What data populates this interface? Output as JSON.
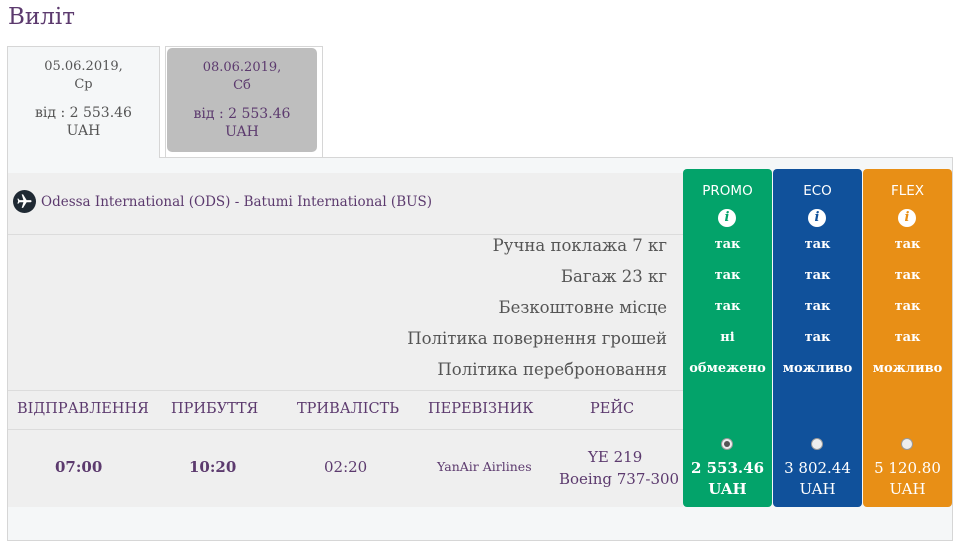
{
  "section_title": "Виліт",
  "date_tabs": [
    {
      "date": "05.06.2019,",
      "weekday": "Ср",
      "price": "від : 2 553.46",
      "currency": "UAH"
    },
    {
      "date": "08.06.2019,",
      "weekday": "Сб",
      "price": "від : 2 553.46",
      "currency": "UAH"
    }
  ],
  "route": "Odessa International (ODS) - Batumi International (BUS)",
  "features": [
    "Ручна поклажа 7 кг",
    "Багаж 23 кг",
    "Безкоштовне місце",
    "Політика повернення грошей",
    "Політика переброню­вання"
  ],
  "features_clean": [
    "Ручна поклажа 7 кг",
    "Багаж 23 кг",
    "Безкоштовне місце",
    "Політика повернення грошей",
    "Політика переброновання"
  ],
  "headers": {
    "departure": "ВІДПРАВЛЕННЯ",
    "arrival": "ПРИБУТТЯ",
    "duration": "ТРИВАЛІСТЬ",
    "carrier": "ПЕРЕВІЗНИК",
    "flight": "РЕЙС"
  },
  "flight": {
    "departure": "07:00",
    "arrival": "10:20",
    "duration": "02:20",
    "carrier": "YanAir Airlines",
    "flight_no": "YE 219",
    "aircraft": "Boeing 737-300"
  },
  "fares": [
    {
      "name": "PROMO",
      "values": [
        "так",
        "так",
        "так",
        "ні",
        "обмежено"
      ],
      "amount": "2 553.46",
      "currency": "UAH",
      "selected": true
    },
    {
      "name": "ECO",
      "values": [
        "так",
        "так",
        "так",
        "так",
        "можливо"
      ],
      "amount": "3 802.44",
      "currency": "UAH",
      "selected": false
    },
    {
      "name": "FLEX",
      "values": [
        "так",
        "так",
        "так",
        "так",
        "можливо"
      ],
      "amount": "5 120.80",
      "currency": "UAH",
      "selected": false
    }
  ],
  "info_glyph": "i",
  "colors": {
    "promo": "#03a36a",
    "eco": "#10519b",
    "flex": "#e88f16",
    "accent": "#5c3a6e"
  },
  "icons": {
    "plane": "airplane-icon",
    "info": "info-icon"
  }
}
